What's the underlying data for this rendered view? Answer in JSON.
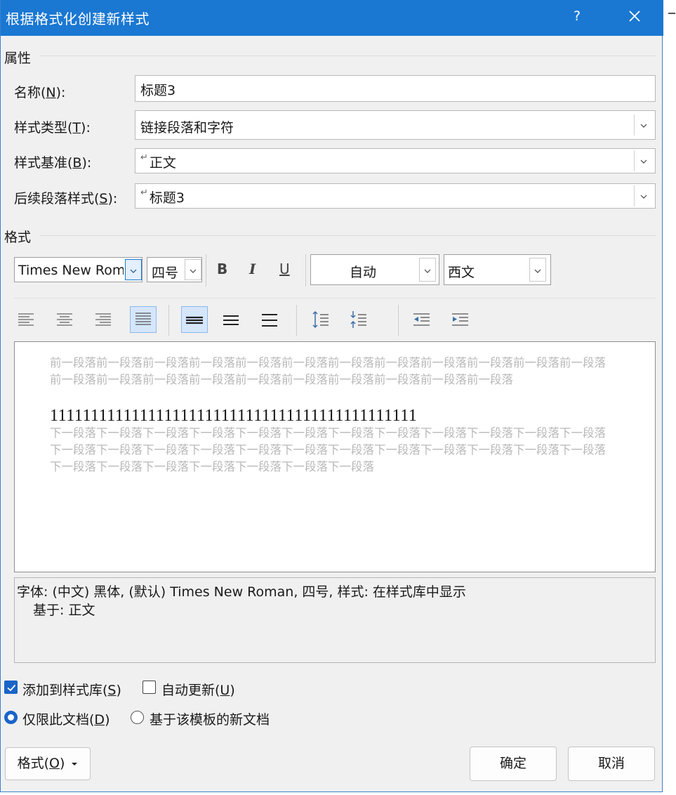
{
  "window": {
    "title": "根据格式化创建新样式",
    "help_label": "?"
  },
  "properties": {
    "section_label": "属性",
    "name": {
      "label_text": "名称(",
      "accel": "N",
      "label_end": "):",
      "value": "标题3"
    },
    "style_type": {
      "label_text": "样式类型(",
      "accel": "T",
      "label_end": "):",
      "value": "链接段落和字符"
    },
    "based_on": {
      "label_text": "样式基准(",
      "accel": "B",
      "label_end": "):",
      "value": "正文"
    },
    "next_style": {
      "label_text": "后续段落样式(",
      "accel": "S",
      "label_end": "):",
      "value": "标题3"
    }
  },
  "format": {
    "section_label": "格式",
    "font_name": "Times New Roman",
    "font_size": "四号",
    "bold": "B",
    "italic": "I",
    "underline": "U",
    "color": "自动",
    "script": "西文"
  },
  "preview": {
    "prev_text": "前一段落前一段落前一段落前一段落前一段落前一段落前一段落前一段落前一段落前一段落前一段落前一段落前一段落前一段落前一段落前一段落前一段落前一段落前一段落前一段落前一段落前一段落",
    "sample_text": "111111111111111111111111111111111111111111111",
    "next_text": "下一段落下一段落下一段落下一段落下一段落下一段落下一段落下一段落下一段落下一段落下一段落下一段落下一段落下一段落下一段落下一段落下一段落下一段落下一段落下一段落下一段落下一段落下一段落下一段落下一段落下一段落下一段落下一段落下一段落下一段落下一段落"
  },
  "description": {
    "line1": "字体: (中文) 黑体, (默认) Times New Roman, 四号, 样式: 在样式库中显示",
    "line2": "基于: 正文"
  },
  "options": {
    "add_to_gallery": {
      "text": "添加到样式库(",
      "accel": "S",
      "end": ")",
      "checked": true
    },
    "auto_update": {
      "text": "自动更新(",
      "accel": "U",
      "end": ")",
      "checked": false
    },
    "this_doc_only": {
      "text": "仅限此文档(",
      "accel": "D",
      "end": ")",
      "selected": true
    },
    "new_docs": {
      "text": "基于该模板的新文档",
      "selected": false
    }
  },
  "buttons": {
    "format_text": "格式(",
    "format_accel": "O",
    "format_end": ")",
    "ok": "确定",
    "cancel": "取消"
  },
  "colors": {
    "title_bar": "#1a78d2",
    "accent": "#1a64c8",
    "dialog_bg": "#f0f0f0"
  }
}
